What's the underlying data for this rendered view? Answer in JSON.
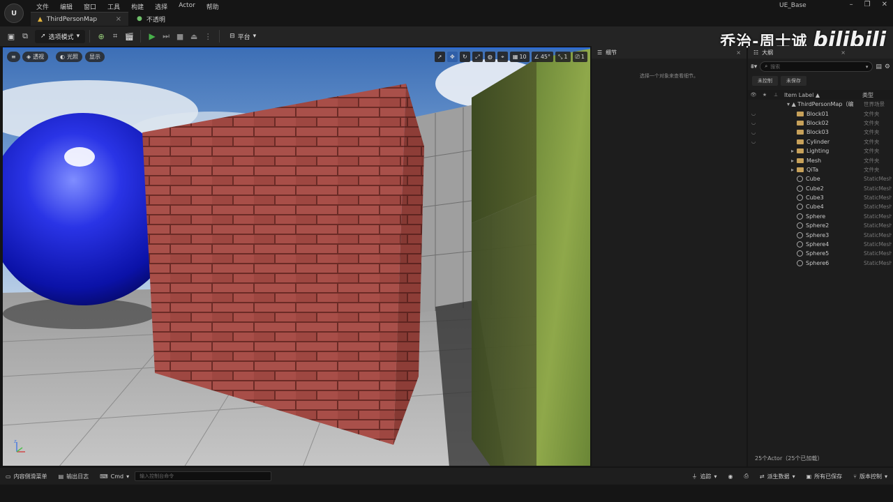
{
  "window": {
    "app_title": "UE_Base"
  },
  "menu": [
    "文件",
    "编辑",
    "窗口",
    "工具",
    "构建",
    "选择",
    "Actor",
    "帮助"
  ],
  "tabs": [
    {
      "label": "ThirdPersonMap"
    },
    {
      "label": "不透明"
    }
  ],
  "toolbar": {
    "mode_label": "选项模式",
    "platform_label": "平台"
  },
  "watermark": {
    "name": "乔治-周士诚",
    "site": "bilibili"
  },
  "viewport": {
    "perspective_label": "透视",
    "lit_label": "光照",
    "show_label": "显示",
    "grid_value": "10",
    "angle_value": "45°",
    "scale_value": "1",
    "camera_speed": "1"
  },
  "details": {
    "tab_label": "细节",
    "empty_hint": "选择一个对象来查看细节。"
  },
  "outliner": {
    "tab_label": "大纲",
    "search_placeholder": "搜索",
    "chip_uncontrolled": "未控制",
    "chip_unsaved": "未保存",
    "col_label": "Item Label ▲",
    "col_type": "类型",
    "root": {
      "label": "ThirdPersonMap（编",
      "type": "世界场景"
    },
    "items": [
      {
        "label": "Block01",
        "type": "文件夹",
        "kind": "folder",
        "expandable": false,
        "eye": true
      },
      {
        "label": "Block02",
        "type": "文件夹",
        "kind": "folder",
        "expandable": false,
        "eye": true
      },
      {
        "label": "Block03",
        "type": "文件夹",
        "kind": "folder",
        "expandable": false,
        "eye": true
      },
      {
        "label": "Cylinder",
        "type": "文件夹",
        "kind": "folder",
        "expandable": false,
        "eye": true
      },
      {
        "label": "Lighting",
        "type": "文件夹",
        "kind": "folder",
        "expandable": true,
        "eye": false
      },
      {
        "label": "Mesh",
        "type": "文件夹",
        "kind": "folder",
        "expandable": true,
        "eye": false
      },
      {
        "label": "QiTa",
        "type": "文件夹",
        "kind": "folder",
        "expandable": true,
        "eye": false
      },
      {
        "label": "Cube",
        "type": "StaticMesh",
        "kind": "mesh",
        "expandable": false,
        "eye": false
      },
      {
        "label": "Cube2",
        "type": "StaticMesh",
        "kind": "mesh",
        "expandable": false,
        "eye": false
      },
      {
        "label": "Cube3",
        "type": "StaticMesh",
        "kind": "mesh",
        "expandable": false,
        "eye": false
      },
      {
        "label": "Cube4",
        "type": "StaticMesh",
        "kind": "mesh",
        "expandable": false,
        "eye": false
      },
      {
        "label": "Sphere",
        "type": "StaticMesh",
        "kind": "mesh",
        "expandable": false,
        "eye": false
      },
      {
        "label": "Sphere2",
        "type": "StaticMesh",
        "kind": "mesh",
        "expandable": false,
        "eye": false
      },
      {
        "label": "Sphere3",
        "type": "StaticMesh",
        "kind": "mesh",
        "expandable": false,
        "eye": false
      },
      {
        "label": "Sphere4",
        "type": "StaticMesh",
        "kind": "mesh",
        "expandable": false,
        "eye": false
      },
      {
        "label": "Sphere5",
        "type": "StaticMesh",
        "kind": "mesh",
        "expandable": false,
        "eye": false
      },
      {
        "label": "Sphere6",
        "type": "StaticMesh",
        "kind": "mesh",
        "expandable": false,
        "eye": false
      }
    ],
    "footer": "25个Actor（25个已加载）"
  },
  "statusbar": {
    "content_drawer": "内容侧滑菜单",
    "output_log": "输出日志",
    "cmd_label": "Cmd",
    "cmd_placeholder": "输入控制台命令",
    "trace_label": "追踪",
    "derived_data": "派生数据",
    "all_saved": "所有已保存",
    "source_control": "版本控制"
  }
}
